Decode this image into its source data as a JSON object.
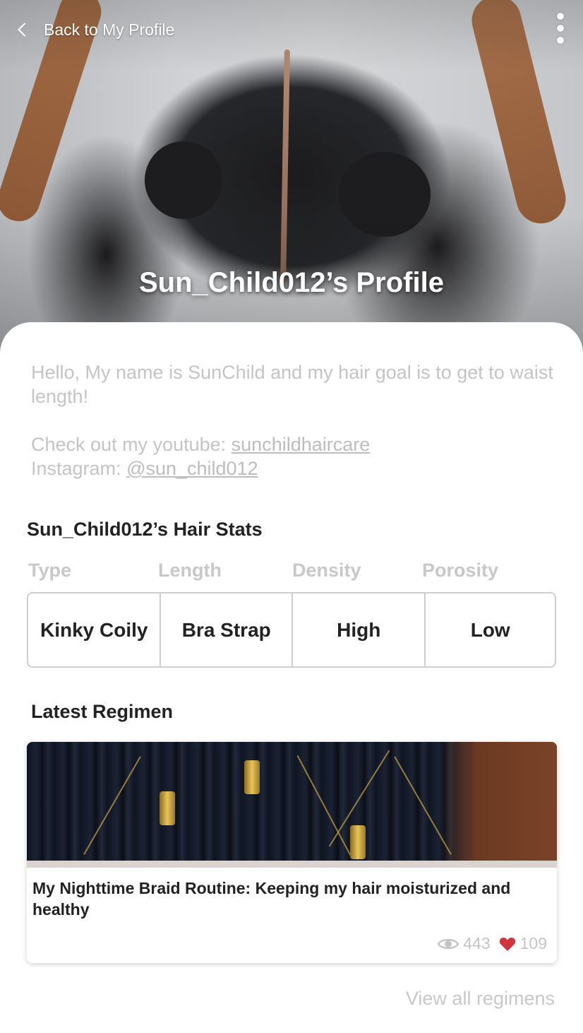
{
  "header": {
    "back_label": "Back to My Profile",
    "title": "Sun_Child012’s Profile"
  },
  "bio": {
    "line1": "Hello, My name is SunChild and my hair goal is to get to waist length!",
    "youtube_prefix": "Check out my youtube: ",
    "youtube_handle": "sunchildhaircare",
    "instagram_prefix": "Instagram: ",
    "instagram_handle": "@sun_child012"
  },
  "stats": {
    "heading": "Sun_Child012’s Hair Stats",
    "labels": [
      "Type",
      "Length",
      "Density",
      "Porosity"
    ],
    "values": [
      "Kinky Coily",
      "Bra Strap",
      "High",
      "Low"
    ]
  },
  "regimen": {
    "heading": "Latest Regimen",
    "card": {
      "title": "My Nighttime Braid Routine: Keeping my hair moisturized and healthy",
      "views": "443",
      "likes": "109",
      "view_icon": "eye-icon",
      "like_icon": "heart-icon",
      "like_color": "#d0343f"
    },
    "view_all_label": "View all regimens"
  },
  "icons": {
    "back": "chevron-left-icon",
    "menu": "kebab-menu-icon"
  }
}
